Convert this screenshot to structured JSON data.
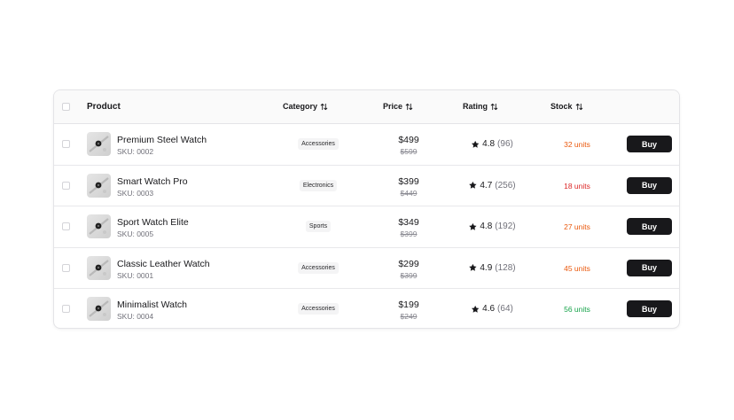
{
  "table": {
    "headers": {
      "product": "Product",
      "category": "Category",
      "price": "Price",
      "rating": "Rating",
      "stock": "Stock"
    },
    "rows": [
      {
        "name": "Premium Steel Watch",
        "sku": "SKU: 0002",
        "category": "Accessories",
        "price": "$499",
        "old_price": "$599",
        "rating": "4.8",
        "reviews": "(96)",
        "stock": "32 units",
        "stock_color": "#ea580c",
        "action": "Buy"
      },
      {
        "name": "Smart Watch Pro",
        "sku": "SKU: 0003",
        "category": "Electronics",
        "price": "$399",
        "old_price": "$449",
        "rating": "4.7",
        "reviews": "(256)",
        "stock": "18 units",
        "stock_color": "#dc2626",
        "action": "Buy"
      },
      {
        "name": "Sport Watch Elite",
        "sku": "SKU: 0005",
        "category": "Sports",
        "price": "$349",
        "old_price": "$399",
        "rating": "4.8",
        "reviews": "(192)",
        "stock": "27 units",
        "stock_color": "#ea580c",
        "action": "Buy"
      },
      {
        "name": "Classic Leather Watch",
        "sku": "SKU: 0001",
        "category": "Accessories",
        "price": "$299",
        "old_price": "$399",
        "rating": "4.9",
        "reviews": "(128)",
        "stock": "45 units",
        "stock_color": "#ea580c",
        "action": "Buy"
      },
      {
        "name": "Minimalist Watch",
        "sku": "SKU: 0004",
        "category": "Accessories",
        "price": "$199",
        "old_price": "$249",
        "rating": "4.6",
        "reviews": "(64)",
        "stock": "56 units",
        "stock_color": "#16a34a",
        "action": "Buy"
      }
    ]
  },
  "icons": {
    "sort": "sort-arrows-icon",
    "star": "star-icon",
    "product_thumbnail": "watch-image"
  },
  "colors": {
    "button_bg": "#18181b",
    "header_bg": "#fafafa",
    "border": "#e4e4e7"
  }
}
